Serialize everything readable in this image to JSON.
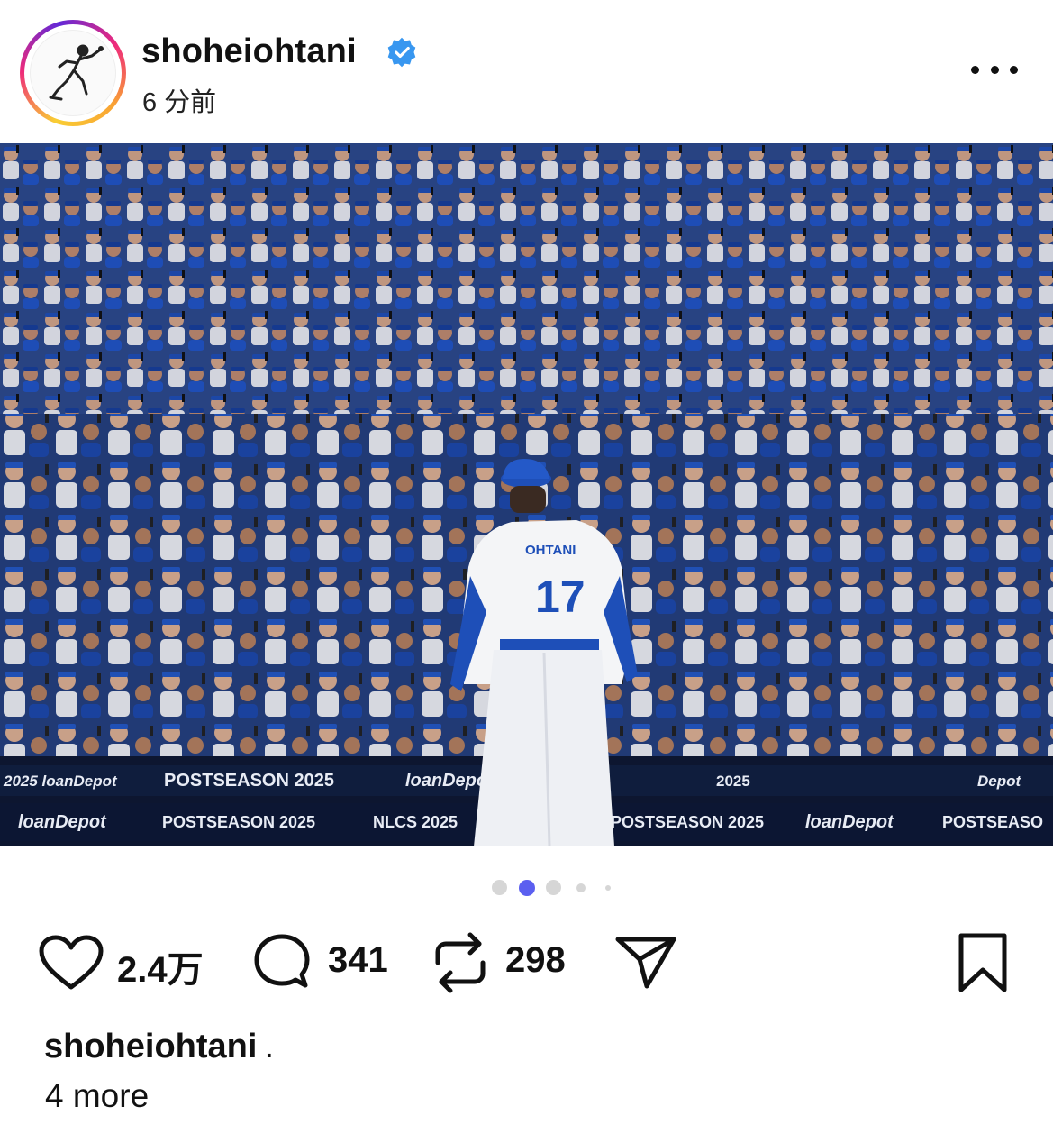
{
  "post": {
    "username": "shoheiohtani",
    "verified": true,
    "time_ago": "6 分前",
    "photo": {
      "jersey_name": "OHTANI",
      "jersey_number": "17",
      "banners": [
        "2025 loanDepot",
        "POSTSEASON 2025",
        "loanDepot",
        "2025",
        "Depot",
        "loanDepot",
        "POSTSEASON 2025",
        "NLCS 2025",
        "POSTSEASON 2025",
        "loanDepot",
        "POSTSEASO"
      ]
    },
    "carousel": {
      "count": 5,
      "active_index": 1,
      "active_color": "#5b5ff0"
    }
  },
  "actions": {
    "likes": "2.4万",
    "comments": "341",
    "reposts": "298"
  },
  "caption": {
    "username": "shoheiohtani",
    "text": ".",
    "more": "4 more"
  },
  "icons": {
    "verified": "verified-badge-icon",
    "more": "more-horizontal-icon",
    "like": "heart-outline-icon",
    "comment": "comment-bubble-icon",
    "repost": "repost-arrows-icon",
    "share": "paper-plane-icon",
    "save": "bookmark-outline-icon"
  },
  "colors": {
    "verified_blue": "#3897f0",
    "dodger_blue": "#1e4fb8",
    "text": "#111111"
  }
}
